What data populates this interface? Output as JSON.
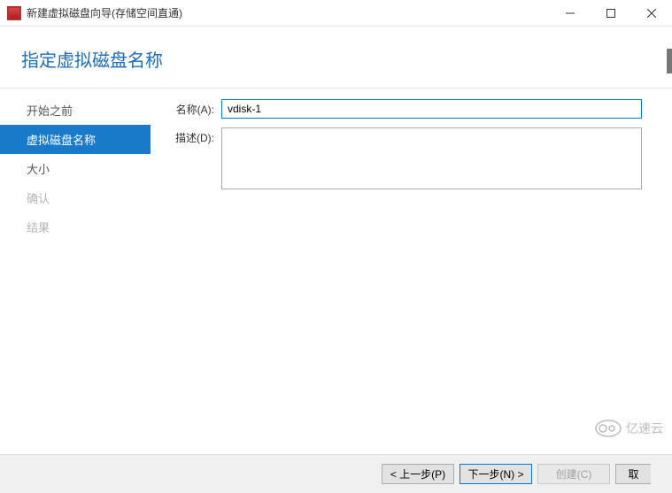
{
  "window": {
    "title": "新建虚拟磁盘向导(存储空间直通)"
  },
  "header": {
    "title": "指定虚拟磁盘名称"
  },
  "sidebar": {
    "items": [
      {
        "label": "开始之前",
        "state": "normal"
      },
      {
        "label": "虚拟磁盘名称",
        "state": "active"
      },
      {
        "label": "大小",
        "state": "normal"
      },
      {
        "label": "确认",
        "state": "disabled"
      },
      {
        "label": "结果",
        "state": "disabled"
      }
    ]
  },
  "form": {
    "name_label": "名称(A):",
    "name_value": "vdisk-1",
    "desc_label": "描述(D):",
    "desc_value": ""
  },
  "footer": {
    "prev": "< 上一步(P)",
    "next": "下一步(N) >",
    "create": "创建(C)",
    "cancel": "取"
  },
  "watermark": "亿速云"
}
